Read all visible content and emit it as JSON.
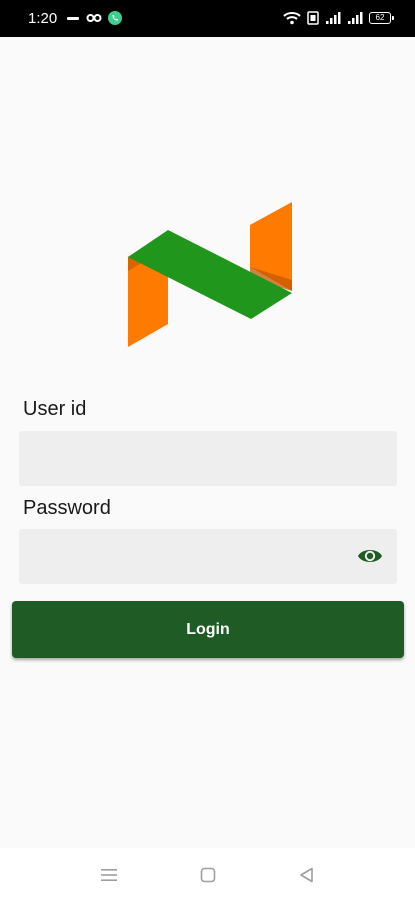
{
  "status_bar": {
    "time": "1:20",
    "battery_level": "62"
  },
  "login_form": {
    "user_id_label": "User id",
    "user_id_value": "",
    "password_label": "Password",
    "password_value": "",
    "login_label": "Login",
    "password_toggle_icon": "eye-icon"
  },
  "logo": {
    "icon": "n-logo-icon",
    "colors": {
      "orange": "#ff7a00",
      "orange_shadow": "#c45a00",
      "green": "#21961c"
    }
  },
  "nav_bar": {
    "items": [
      "menu-icon",
      "home-icon",
      "back-icon"
    ]
  },
  "colors": {
    "accent": "#1e5b25",
    "eye_icon": "#1e5b25",
    "input_background": "#eeeeee",
    "page_background": "#fafafa"
  }
}
